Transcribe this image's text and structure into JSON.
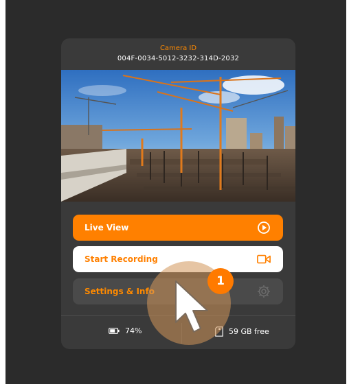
{
  "camera": {
    "label": "Camera ID",
    "id": "004F-0034-5012-3232-314D-2032"
  },
  "preview": {
    "description_icon": "construction-site-photo"
  },
  "actions": {
    "live_view": {
      "label": "Live View",
      "icon": "play-circle-icon"
    },
    "start_recording": {
      "label": "Start Recording",
      "icon": "video-camera-icon"
    },
    "settings": {
      "label": "Settings & Info",
      "icon": "gear-icon"
    }
  },
  "status": {
    "battery": {
      "value": "74%",
      "icon": "battery-icon"
    },
    "storage": {
      "value": "59 GB free",
      "icon": "sd-card-icon"
    }
  },
  "tutorial": {
    "step": "1"
  },
  "colors": {
    "accent": "#ff8000",
    "card": "#3a3a3a",
    "background": "#2b2b2b"
  }
}
